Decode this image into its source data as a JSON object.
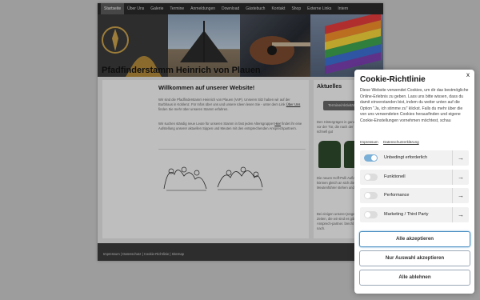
{
  "nav": {
    "items": [
      "Startseite",
      "Über Uns",
      "Galerie",
      "Termine",
      "Anmeldungen",
      "Download",
      "Gästebuch",
      "Kontakt",
      "Shop",
      "Externe Links",
      "Intern"
    ],
    "active_index": 0
  },
  "site": {
    "title": "Pfadfinderstamm Heinrich von Plauen"
  },
  "main": {
    "welcome": "Willkommen auf unserer Website!",
    "para1": "Wir sind die Pfadfinderstamm Heinrich von Plauen (VsP). Unseren Sitz haben wir auf der Burbhaus in Koblenz. Für Infos über uns und unsere Ideen lesen Sie - unter dem Link",
    "para1_link": "Über Uns",
    "para1_end": "finden Sie mehr über unseren Stamm erfahren.",
    "para2": "Wir suchen ständig neue Leute für unseren Stamm in fast jeden Altersgruppe!",
    "para2_link": "Hier",
    "para2_end": "findet ihr eine Aufstellung unserer aktuellen Sippen und Meuten mit den entsprechenden Ansprechpartnern."
  },
  "sidebar": {
    "title": "Aktuelles",
    "button": "Termine/Aktivitäten",
    "text1": "Den Hintergrägen in ganz oben und unten vor der Tür, die nach der Mode noch schnell gut",
    "text2": "Die neuen Hoff-Pulli Auflage fertig und können gleich an sich die Sippen- und Meutenführer stehen und melden werden.",
    "text3": "Bei einigen unserer jüngeren haben wir die Zeiten, die wir sind es gibt bewahrend Ansprech-partner. brecht und so weit mal nach."
  },
  "footer": {
    "text": "Impressum | Datenschutz | Cookie-Richtlinie | Sitemap"
  },
  "cookie": {
    "title": "Cookie-Richtlinie",
    "close": "x",
    "text": "Diese Website verwendet Cookies, um dir das bestmögliche Online-Erlebnis zu geben. Lass uns bitte wissen, dass du damit einverstanden bist, indem du weiter unten auf die Option \"Ja, ich stimme zu\" klickst. Falls du mehr über die von uns verwendeten Cookies herausfinden und eigene Cookie-Einstellungen vornehmen möchtest, schau",
    "link_imprint": "Impressum",
    "link_privacy": "Datenschutzerklärung",
    "categories": [
      {
        "label": "Unbedingt erforderlich",
        "enabled": true
      },
      {
        "label": "Funktionell",
        "enabled": false
      },
      {
        "label": "Performance",
        "enabled": false
      },
      {
        "label": "Marketing / Third Party",
        "enabled": false
      }
    ],
    "arrow_glyph": "→",
    "accept_all": "Alle akzeptieren",
    "accept_selection": "Nur Auswahl akzeptieren",
    "reject_all": "Alle ablehnen"
  }
}
